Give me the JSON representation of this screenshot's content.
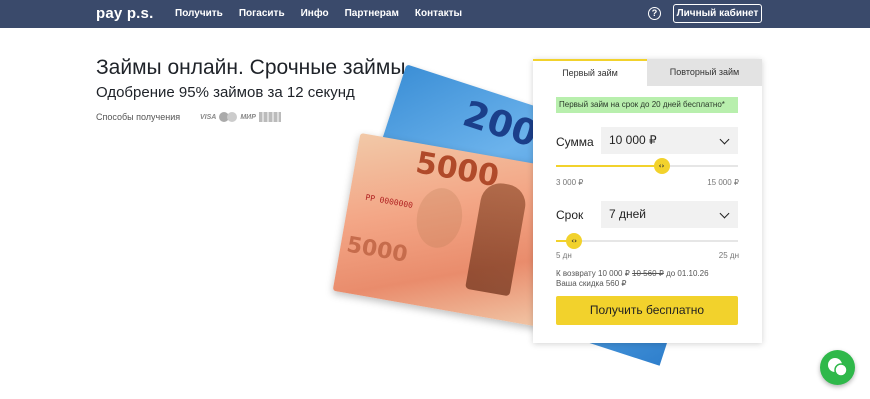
{
  "header": {
    "logo": "pay p.s.",
    "nav": [
      "Получить",
      "Погасить",
      "Инфо",
      "Партнерам",
      "Контакты"
    ],
    "help_icon": "question-circle-icon",
    "cabinet_label": "Личный кабинет"
  },
  "hero": {
    "title": "Займы онлайн. Срочные займы",
    "subtitle": "Одобрение 95% займов за 12 секунд",
    "methods_label": "Способы получения",
    "pay_logos": [
      "VISA",
      "MasterCard",
      "МИР",
      "RK"
    ]
  },
  "banknotes": {
    "note1": "2000",
    "note2": "5000",
    "serial": "PP 0000000"
  },
  "loan_form": {
    "tabs": [
      {
        "label": "Первый займ",
        "active": true
      },
      {
        "label": "Повторный займ",
        "active": false
      }
    ],
    "promo": "Первый займ на срок до 20 дней бесплатно*",
    "amount": {
      "label": "Сумма",
      "value": "10 000 ₽",
      "min": "3 000 ₽",
      "max": "15 000 ₽",
      "level": 0.58
    },
    "term": {
      "label": "Срок",
      "value": "7 дней",
      "min": "5 дн",
      "max": "25 дн",
      "level": 0.1
    },
    "summary": {
      "prefix": "К возврату 10 000 ₽",
      "old": "10 560 ₽",
      "suffix": "до 01.10.26",
      "discount": "Ваша скидка 560 ₽"
    },
    "cta": "Получить бесплатно"
  },
  "colors": {
    "header_bg": "#3a4a6b",
    "accent": "#f2d22c",
    "promo_bg": "#b8efad",
    "chat": "#2fb84a"
  }
}
